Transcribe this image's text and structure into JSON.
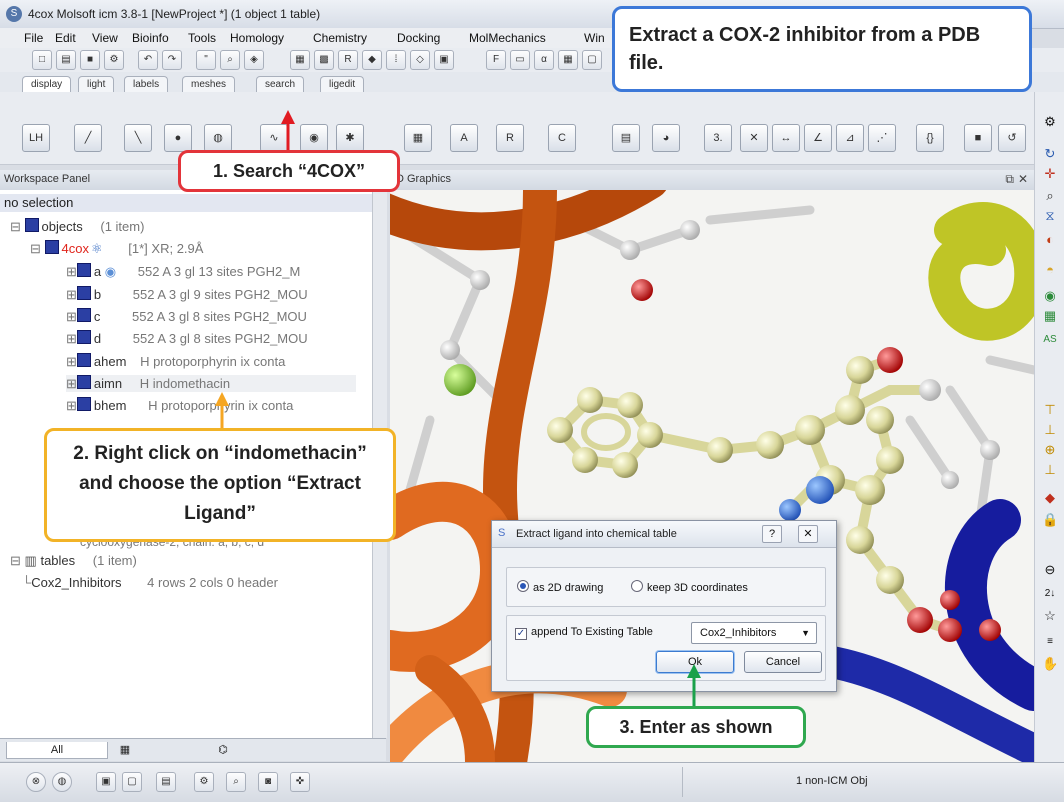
{
  "window": {
    "title": "4cox Molsoft icm 3.8-1  [NewProject *] (1 object 1 table)"
  },
  "menu": [
    "File",
    "Edit",
    "View",
    "Bioinfo",
    "Tools",
    "Homology",
    "Chemistry",
    "Docking",
    "MolMechanics",
    "Win"
  ],
  "tabs": [
    "display",
    "light",
    "labels",
    "meshes",
    "search",
    "ligedit"
  ],
  "workspace": {
    "header": "Workspace Panel",
    "no_selection": "no selection",
    "objects_label": "objects",
    "objects_count": "(1 item)",
    "object_name": "4cox",
    "object_info": "[1*] XR; 2.9Å",
    "chains": [
      {
        "name": "a",
        "info": "552 A 3 gl  13 sites PGH2_M"
      },
      {
        "name": "b",
        "info": "552 A 3 gl  9 sites PGH2_MOU"
      },
      {
        "name": "c",
        "info": "552 A 3 gl  8 sites PGH2_MOU"
      },
      {
        "name": "d",
        "info": "552 A 3 gl  8 sites PGH2_MOU"
      },
      {
        "name": "ahem",
        "info": "H   protoporphyrin ix conta"
      },
      {
        "name": "aimn",
        "info": "H   indomethacin"
      },
      {
        "name": "bhem",
        "info": "H   protoporphyrin ix conta"
      }
    ],
    "partial_row": "cyclooxygenase-2, chain: a, b, c, d",
    "tables_label": "tables",
    "tables_count": "(1 item)",
    "table_name": "Cox2_Inhibitors",
    "table_info": "4 rows 2 cols 0 header"
  },
  "bottom_tabs": {
    "all": "All"
  },
  "graphics": {
    "header": "3D Graphics",
    "partial_header": "D Graphics"
  },
  "status": {
    "message": "1 non-ICM Obj"
  },
  "callouts": {
    "top": "Extract a COX-2 inhibitor from a PDB file.",
    "step1": "1. Search “4COX”",
    "step2": "2. Right click on “indomethacin” and choose the option “Extract Ligand”",
    "step3": "3. Enter as shown"
  },
  "dialog": {
    "title": "Extract ligand into chemical table",
    "radio_2d": "as 2D drawing",
    "radio_3d": "keep 3D coordinates",
    "append_label": "append To Existing Table",
    "table_select": "Cox2_Inhibitors",
    "ok": "Ok",
    "cancel": "Cancel",
    "radio_2d_checked": true,
    "append_checked": true
  },
  "colors": {
    "callout_blue": "#3c78d8",
    "callout_red": "#e3343a",
    "callout_orange": "#f2b327",
    "callout_green": "#2fa84f",
    "arrow_red": "#e11b22",
    "arrow_orange": "#f5a623",
    "arrow_green": "#1aa14a"
  }
}
